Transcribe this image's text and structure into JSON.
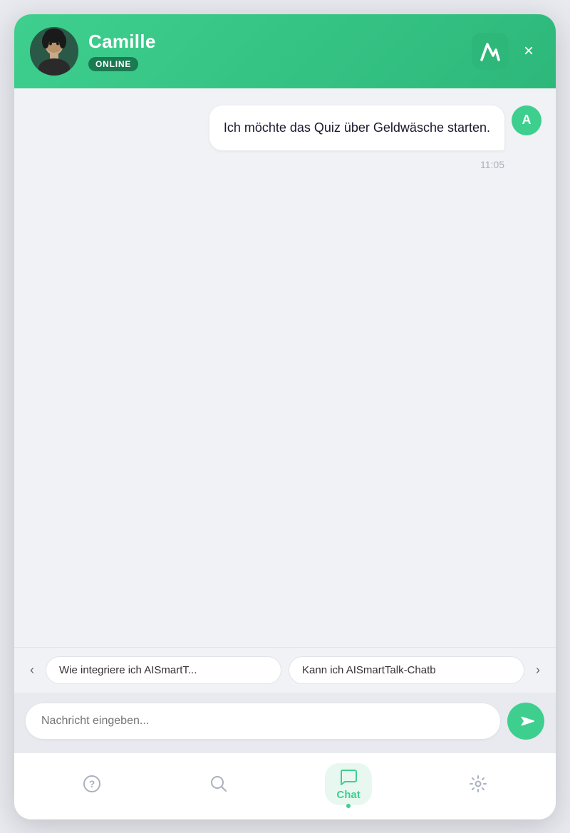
{
  "header": {
    "agent_name": "Camille",
    "status": "ONLINE",
    "close_label": "×",
    "user_initial": "A"
  },
  "messages": [
    {
      "id": 1,
      "text": "Ich möchte das Quiz über Geldwäsche starten.",
      "sender": "user",
      "timestamp": "11:05"
    }
  ],
  "suggestions": [
    {
      "label": "Wie integriere ich AISmartT...",
      "full": "Wie integriere ich AISmartTalk?"
    },
    {
      "label": "Kann ich AISmartTalk-Chatb",
      "full": "Kann ich AISmartTalk-Chatbot nutzen?"
    }
  ],
  "input": {
    "placeholder": "Nachricht eingeben..."
  },
  "nav": {
    "items": [
      {
        "id": "help",
        "label": "",
        "icon": "help-icon",
        "active": false
      },
      {
        "id": "search",
        "label": "",
        "icon": "search-icon",
        "active": false
      },
      {
        "id": "chat",
        "label": "Chat",
        "icon": "chat-icon",
        "active": true
      },
      {
        "id": "settings",
        "label": "",
        "icon": "settings-icon",
        "active": false
      }
    ]
  },
  "colors": {
    "green": "#3ecf8e",
    "dark_green": "#2db87a",
    "text_dark": "#1a1a2e",
    "text_muted": "#aab0be"
  }
}
